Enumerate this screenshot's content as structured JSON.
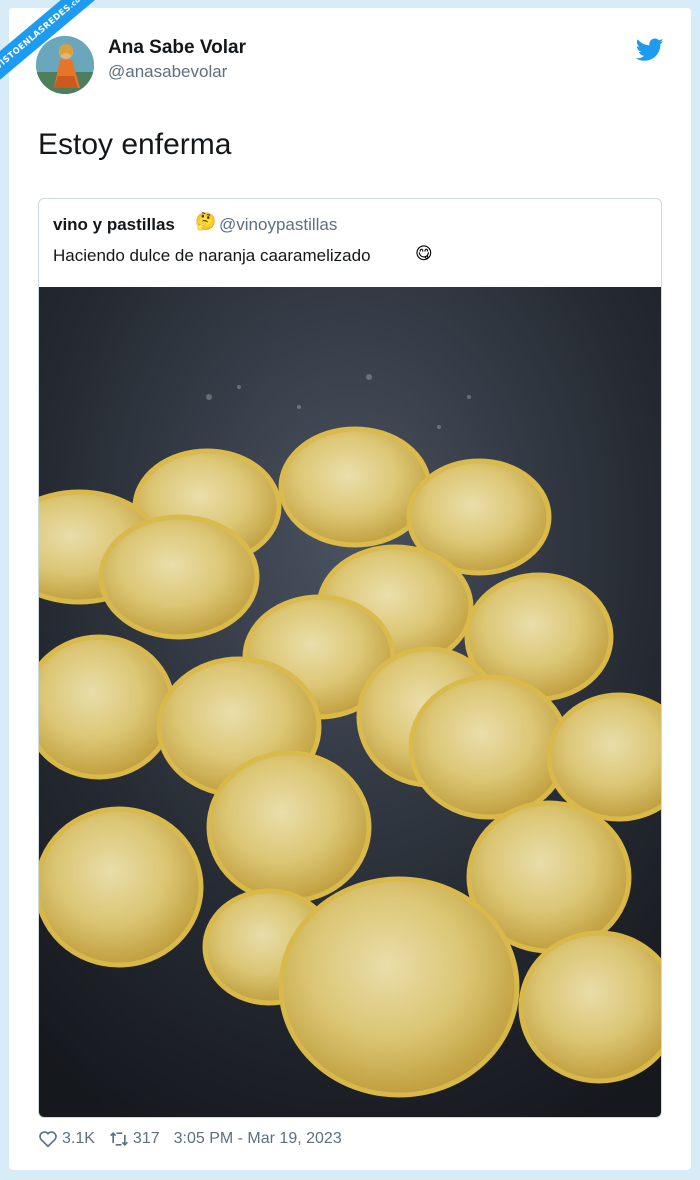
{
  "watermark": {
    "text": "VISTOENLASREDES",
    "sub": ".com"
  },
  "tweet": {
    "author_name": "Ana Sabe Volar",
    "author_handle": "@anasabevolar",
    "text": "Estoy enferma",
    "platform_icon": "twitter-bird-icon",
    "likes": "3.1K",
    "retweets": "317",
    "timestamp": "3:05 PM - Mar 19, 2023"
  },
  "quoted_tweet": {
    "author_name": "vino y pastillas",
    "name_emoji": "🤔",
    "author_handle": "@vinoypastillas",
    "text": "Haciendo dulce de naranja caaramelizado",
    "text_emoji": "😋",
    "image_description_icon": "photo-caramelized-citrus-slices"
  },
  "colors": {
    "accent": "#1d9bf0",
    "background": "#d7ecf7",
    "text_primary": "#14171a",
    "text_secondary": "#5b7083"
  }
}
